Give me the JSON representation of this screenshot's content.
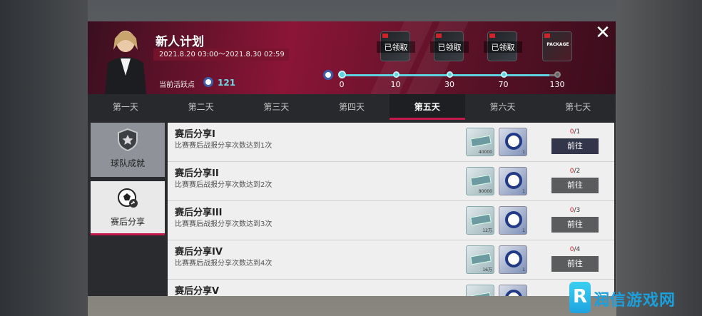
{
  "header": {
    "title": "新人计划",
    "date_range": "2021.8.20 03:00～2021.8.30 02:59",
    "activity_label": "当前活跃点",
    "activity_value": "121",
    "close_icon": "close-icon"
  },
  "rewards": [
    {
      "label": "已领取"
    },
    {
      "label": "已领取"
    },
    {
      "label": "已领取"
    },
    {
      "label": "PACKAGE"
    }
  ],
  "progress": {
    "current": 121,
    "milestones": [
      "0",
      "10",
      "30",
      "70",
      "130"
    ]
  },
  "tabs": [
    "第一天",
    "第二天",
    "第三天",
    "第四天",
    "第五天",
    "第六天",
    "第七天"
  ],
  "active_tab": "第五天",
  "sidebar": [
    {
      "label": "球队成就",
      "icon": "star-shield-icon"
    },
    {
      "label": "赛后分享",
      "icon": "football-share-icon"
    }
  ],
  "tasks": [
    {
      "name": "赛后分享I",
      "desc": "比赛赛后战报分享次数达到1次",
      "cash": "40000",
      "ball": "1",
      "done": "0",
      "total": "/1",
      "action": "前往"
    },
    {
      "name": "赛后分享II",
      "desc": "比赛赛后战报分享次数达到2次",
      "cash": "80000",
      "ball": "1",
      "done": "0",
      "total": "/2",
      "action": "前往"
    },
    {
      "name": "赛后分享III",
      "desc": "比赛赛后战报分享次数达到3次",
      "cash": "12万",
      "ball": "1",
      "done": "0",
      "total": "/3",
      "action": "前往"
    },
    {
      "name": "赛后分享IV",
      "desc": "比赛赛后战报分享次数达到4次",
      "cash": "16万",
      "ball": "1",
      "done": "0",
      "total": "/4",
      "action": "前往"
    },
    {
      "name": "赛后分享V",
      "desc": "",
      "cash": "",
      "ball": "",
      "done": "",
      "total": "",
      "action": ""
    }
  ],
  "watermark": "润信游戏网",
  "colors": {
    "accent": "#c2184c",
    "header": "#8b1537",
    "progress": "#5fd2e0"
  }
}
